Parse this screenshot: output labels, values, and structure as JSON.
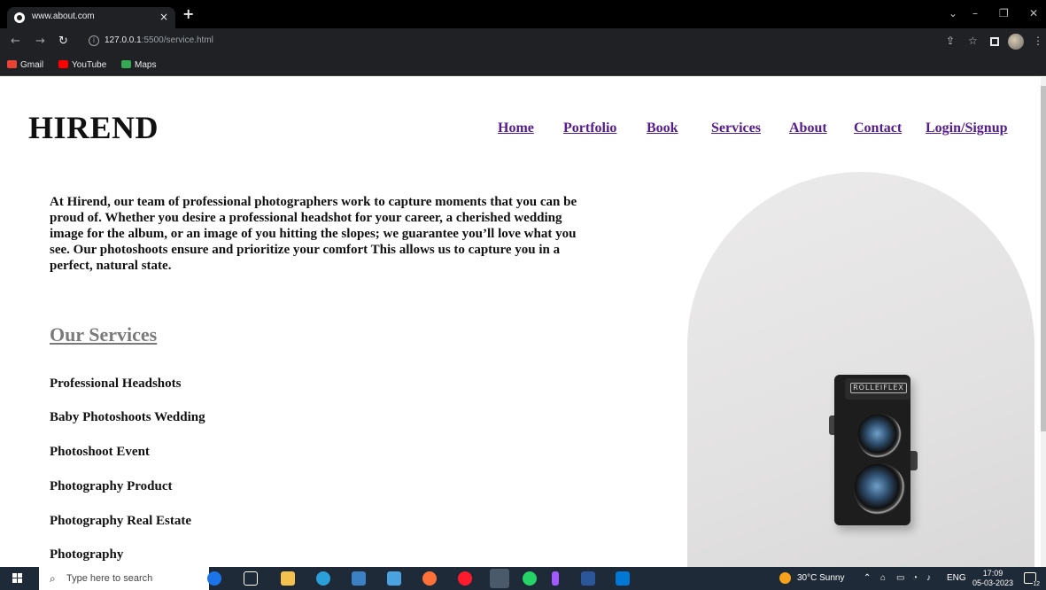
{
  "browser": {
    "tab_title": "www.about.com",
    "tab_close": "×",
    "new_tab": "+",
    "url_host": "127.0.0.1",
    "url_rest": ":5500/service.html",
    "info_icon": "i",
    "bookmarks": [
      {
        "label": "Gmail",
        "icon": "gmail-icon",
        "color": "#ea4335"
      },
      {
        "label": "YouTube",
        "icon": "youtube-icon",
        "color": "#ff0000"
      },
      {
        "label": "Maps",
        "icon": "maps-icon",
        "color": "#34a853"
      }
    ]
  },
  "site": {
    "logo": "HIREND",
    "nav": [
      "Home",
      "Portfolio",
      "Book",
      "Services",
      "About",
      "Contact",
      "Login/Signup"
    ],
    "nav_color": "#551a8b",
    "intro": "At Hirend, our team of professional photographers work to capture moments that you can be proud of. Whether you desire a professional headshot for your career, a cherished wedding image for the album, or an image of you hitting the slopes; we guarantee you’ll love what you see. Our photoshoots ensure and prioritize your comfort This allows us to capture you in a perfect, natural state.",
    "services_heading": "Our Services",
    "services": [
      "Professional Headshots",
      "Baby Photoshoots Wedding",
      "Photoshoot Event",
      "Photography Product",
      "Photography Real Estate",
      "Photography"
    ],
    "camera_brand": "ROLLEIFLEX"
  },
  "taskbar": {
    "search_placeholder": "Type here to search",
    "weather": "30°C  Sunny",
    "language": "ENG",
    "time": "17:09",
    "date": "05-03-2023",
    "notifications": "12"
  }
}
